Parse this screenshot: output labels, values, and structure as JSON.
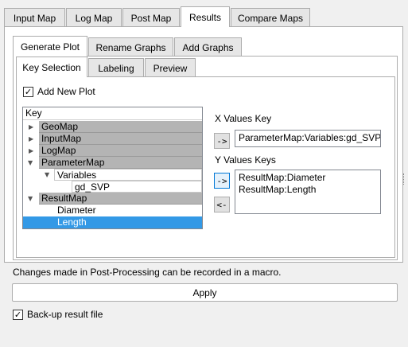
{
  "main_tabs": [
    "Input Map",
    "Log Map",
    "Post Map",
    "Results",
    "Compare Maps"
  ],
  "sub_tabs": [
    "Generate Plot",
    "Rename Graphs",
    "Add Graphs"
  ],
  "inner_tabs": [
    "Key Selection",
    "Labeling",
    "Preview"
  ],
  "add_new_plot": {
    "label": "Add New Plot",
    "checked": "✓"
  },
  "tree": {
    "header": "Key",
    "rows": [
      {
        "label": "GeoMap"
      },
      {
        "label": "InputMap"
      },
      {
        "label": "LogMap"
      },
      {
        "label": "ParameterMap"
      },
      {
        "label": "Variables"
      },
      {
        "label": "gd_SVP"
      },
      {
        "label": "ResultMap"
      },
      {
        "label": "Diameter"
      },
      {
        "label": "Length"
      }
    ]
  },
  "x_values": {
    "label": "X Values Key",
    "button": "->",
    "value": "ParameterMap:Variables:gd_SVP"
  },
  "y_values": {
    "label": "Y Values Keys",
    "add_button": "->",
    "remove_button": "<-",
    "items": [
      "ResultMap:Diameter",
      "ResultMap:Length"
    ]
  },
  "info_text": "Changes made in Post-Processing can be recorded in a macro.",
  "apply_label": "Apply",
  "backup": {
    "label": "Back-up result file",
    "checked": "✓"
  }
}
